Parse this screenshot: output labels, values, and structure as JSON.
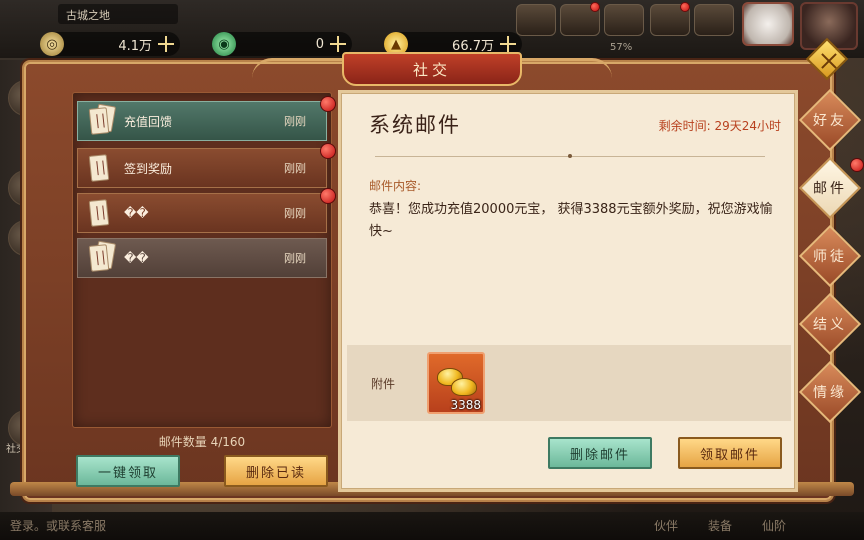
{
  "hud": {
    "location": "古城之地",
    "currencies": [
      {
        "icon": "coin-icon",
        "value": "4.1万"
      },
      {
        "icon": "jade-icon",
        "value": "0"
      },
      {
        "icon": "gold-ingot-icon",
        "value": "66.7万"
      }
    ],
    "energy_percent": "57%"
  },
  "dialog": {
    "title": "社交"
  },
  "mail_list": {
    "items": [
      {
        "title": "充值回馈",
        "time": "刚刚",
        "state": "selected",
        "unread": true
      },
      {
        "title": "签到奖励",
        "time": "刚刚",
        "state": "unread",
        "unread": true
      },
      {
        "title": "��",
        "time": "刚刚",
        "state": "unread",
        "unread": true
      },
      {
        "title": "��",
        "time": "刚刚",
        "state": "read",
        "unread": false
      }
    ],
    "count_label": "邮件数量 4/160",
    "claim_all_label": "一键领取",
    "delete_read_label": "删除已读"
  },
  "detail": {
    "title": "系统邮件",
    "remaining_time": "剩余时间: 29天24小时",
    "content_label": "邮件内容:",
    "content_text": "恭喜！您成功充值20000元宝， 获得3388元宝额外奖励，祝您游戏愉快~",
    "attachment_label": "附件",
    "attachment": {
      "icon": "gold-ingot-icon",
      "quantity": "3388"
    },
    "delete_label": "删除邮件",
    "claim_label": "领取邮件"
  },
  "side_tabs": [
    {
      "label": "好友",
      "active": false,
      "dot": false
    },
    {
      "label": "邮件",
      "active": true,
      "dot": true
    },
    {
      "label": "师徒",
      "active": false,
      "dot": false
    },
    {
      "label": "结义",
      "active": false,
      "dot": false
    },
    {
      "label": "情缘",
      "active": false,
      "dot": false
    }
  ],
  "background": {
    "left_labels": [
      "社交"
    ],
    "bottom_hint": "登录。或联系客服",
    "bottom_nav": [
      "伙伴",
      "装备",
      "仙阶"
    ]
  },
  "colors": {
    "accent_red": "#c01010",
    "selected_mail": "#52786a",
    "remaining_time": "#b8401e"
  }
}
